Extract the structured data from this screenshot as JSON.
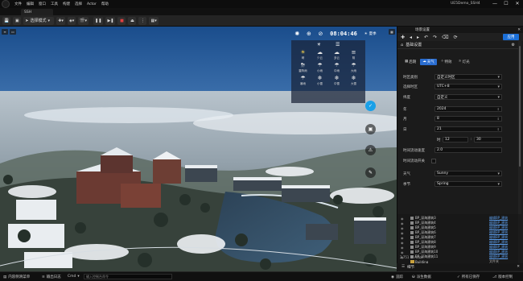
{
  "titlebar": {
    "menus": [
      "文件",
      "编辑",
      "窗口",
      "工具",
      "构建",
      "选择",
      "Actor",
      "帮助"
    ],
    "app_title": "UE5Demo_SSH4",
    "minimize": "—",
    "maximize": "☐",
    "close": "✕"
  },
  "doc_tab": {
    "label": "SSH"
  },
  "toolbar": {
    "mode_label": "选择模式"
  },
  "viewport": {
    "hud": {
      "clock": "08:04:46",
      "season": "夏季"
    },
    "weather_tabs": [
      "☀",
      "☰"
    ],
    "weather_items": [
      {
        "label": "晴",
        "glyph": "☀"
      },
      {
        "label": "少云",
        "glyph": "☁"
      },
      {
        "label": "多云",
        "glyph": "☁"
      },
      {
        "label": "阴",
        "glyph": "≡"
      },
      {
        "label": "雷阵雨",
        "glyph": "⛈"
      },
      {
        "label": "小雨",
        "glyph": "☂"
      },
      {
        "label": "中雨",
        "glyph": "☂"
      },
      {
        "label": "大雨",
        "glyph": "☂"
      },
      {
        "label": "暴雨",
        "glyph": "☂"
      },
      {
        "label": "小雪",
        "glyph": "❄"
      },
      {
        "label": "中雪",
        "glyph": "❄"
      },
      {
        "label": "大雪",
        "glyph": "❄"
      }
    ]
  },
  "world_settings": {
    "panel_tab": "场景设置",
    "apply_label": "应用",
    "title": "基础设置",
    "tabs": [
      "后期",
      "天气",
      "特效",
      "灯光"
    ],
    "properties": [
      {
        "label": "时区类别",
        "value": "自定义时区",
        "kind": "dropdown"
      },
      {
        "label": "选择时区",
        "value": "UTC+8",
        "kind": "dropdown"
      },
      {
        "label": "纬度",
        "value": "自定义",
        "kind": "dropdown"
      },
      {
        "label": "年",
        "value": "2024",
        "kind": "spin"
      },
      {
        "label": "月",
        "value": "8",
        "kind": "spin"
      },
      {
        "label": "日",
        "value": "21",
        "kind": "spin"
      }
    ],
    "time": {
      "label": "时",
      "hour": "12",
      "minute": "30"
    },
    "time_speed": {
      "label": "时间流动速度",
      "value": "2.0"
    },
    "time_flow": {
      "label": "时间流动开关"
    },
    "weather": {
      "label": "天气",
      "value": "Sunny"
    },
    "season": {
      "label": "季节",
      "value": "Spring"
    }
  },
  "outliner": {
    "rows": [
      {
        "name": "BP_深海建筑3",
        "type": "编辑BP_建筑"
      },
      {
        "name": "BP_深海建筑4",
        "type": "编辑BP_建筑"
      },
      {
        "name": "BP_深海建筑5",
        "type": "编辑BP_建筑"
      },
      {
        "name": "BP_深海建筑6",
        "type": "编辑BP_建筑"
      },
      {
        "name": "BP_深海建筑7",
        "type": "编辑BP_建筑"
      },
      {
        "name": "BP_深海建筑8",
        "type": "编辑BP_建筑"
      },
      {
        "name": "BP_深海建筑9",
        "type": "编辑BP_建筑"
      },
      {
        "name": "BP_深海建筑10",
        "type": "编辑BP_建筑"
      },
      {
        "name": "BP_深海建筑11",
        "type": "编辑BP_建筑"
      }
    ],
    "folders": [
      {
        "name": "Building",
        "type": "文件夹"
      },
      {
        "name": "SSH_Hall",
        "type": "文件夹"
      }
    ],
    "actor_count": "2,751 个 Actor"
  },
  "bottom_tabs": {
    "details": "细节"
  },
  "statusbar": {
    "content_drawer": "内容侧滑菜单",
    "output_log": "输出日志",
    "cmd": "Cmd",
    "cmd_placeholder": "输入控制台命令",
    "trace": "追踪",
    "derived": "派生数据",
    "source_control": "所有已保存",
    "revision": "版本控制"
  }
}
